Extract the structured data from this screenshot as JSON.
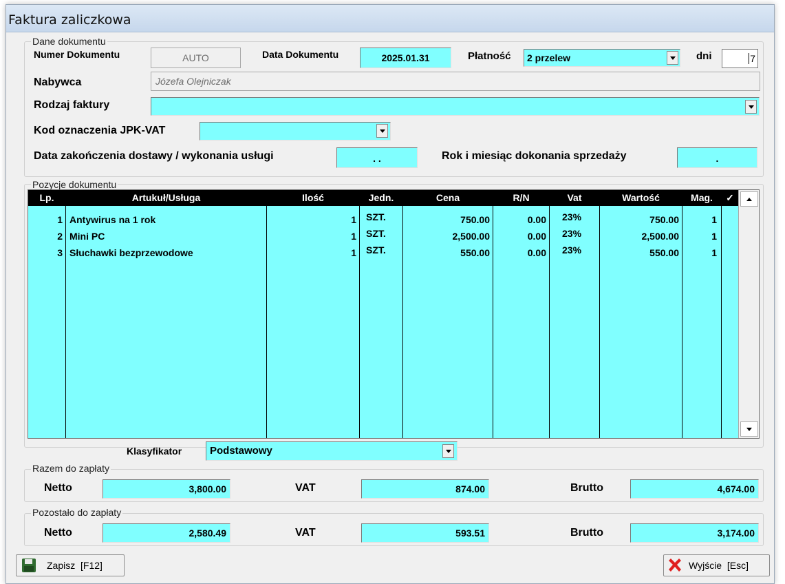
{
  "window": {
    "title": "Faktura zaliczkowa"
  },
  "dane": {
    "legend": "Dane dokumentu",
    "numer_label": "Numer Dokumentu",
    "numer_value": "AUTO",
    "data_label": "Data Dokumentu",
    "data_value": "2025.01.31",
    "platnosc_label": "Płatność",
    "platnosc_value": "2 przelew",
    "dni_label": "dni",
    "dni_value": "7",
    "nabywca_label": "Nabywca",
    "nabywca_value": "Józefa Olejniczak",
    "rodzaj_label": "Rodzaj faktury",
    "rodzaj_value": "",
    "jpk_label": "Kod oznaczenia JPK-VAT",
    "jpk_value": "",
    "dostawa_label": "Data zakończenia dostawy / wykonania usługi",
    "dostawa_value": ". .",
    "rok_label": "Rok i miesiąc dokonania sprzedaży",
    "rok_value": "."
  },
  "pozycje": {
    "legend": "Pozycje dokumentu",
    "columns": [
      "Lp.",
      "Artukuł/Usługa",
      "Ilość",
      "Jedn.",
      "Cena",
      "R/N",
      "Vat",
      "Wartość",
      "Mag.",
      "✓"
    ],
    "rows": [
      [
        "1",
        "Antywirus na 1 rok",
        "1",
        "SZT.",
        "750.00",
        "0.00",
        "23%",
        "750.00",
        "1"
      ],
      [
        "2",
        "Mini PC",
        "1",
        "SZT.",
        "2,500.00",
        "0.00",
        "23%",
        "2,500.00",
        "1"
      ],
      [
        "3",
        "Słuchawki bezprzewodowe",
        "1",
        "SZT.",
        "550.00",
        "0.00",
        "23%",
        "550.00",
        "1"
      ]
    ]
  },
  "klasyfikator": {
    "label": "Klasyfikator",
    "value": "Podstawowy"
  },
  "razem": {
    "legend": "Razem do zapłaty",
    "netto_label": "Netto",
    "netto": "3,800.00",
    "vat_label": "VAT",
    "vat": "874.00",
    "brutto_label": "Brutto",
    "brutto": "4,674.00"
  },
  "pozostalo": {
    "legend": "Pozostało do zapłaty",
    "netto_label": "Netto",
    "netto": "2,580.49",
    "vat_label": "VAT",
    "vat": "593.51",
    "brutto_label": "Brutto",
    "brutto": "3,174.00"
  },
  "buttons": {
    "save": "Zapisz  [F12]",
    "exit": "Wyjście  [Esc]"
  },
  "colors": {
    "field": "#80ffff",
    "header": "#000000",
    "exit_icon": "#e02020",
    "save_icon": "#2f6b2f"
  },
  "icons": {
    "save": "floppy-disk-icon",
    "exit": "red-x-icon",
    "dropdown": "chevron-down-icon"
  }
}
